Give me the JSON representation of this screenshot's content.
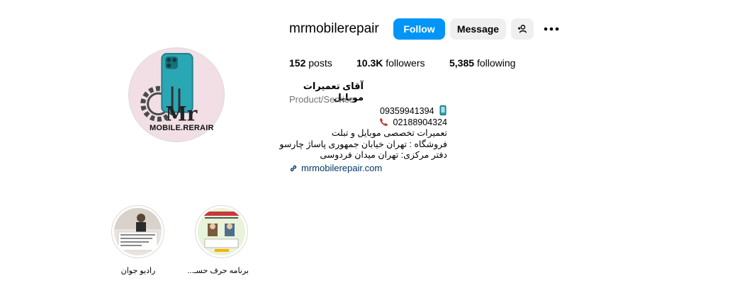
{
  "profile": {
    "username": "mrmobilerepair",
    "avatar_caption": "MOBILE.RERAIR",
    "full_name": "آقای تعمیرات موبایل",
    "category": "Product/Service"
  },
  "actions": {
    "follow_label": "Follow",
    "message_label": "Message",
    "add_user_icon": "add-user-icon",
    "more_icon": "more-icon"
  },
  "stats": {
    "posts_count": "152",
    "posts_label": "posts",
    "followers_count": "10.3K",
    "followers_label": "followers",
    "following_count": "5,385",
    "following_label": "following"
  },
  "bio": {
    "mobile": "09359941394",
    "landline": "02188904324",
    "line1": "تعمیرات تخصصی موبایل و تبلت",
    "line2": "فروشگاه : تهران خیابان جمهوری پاساژ چارسو",
    "line3": "دفتر مرکزی: تهران میدان فردوسی",
    "website": "mrmobilerepair.com"
  },
  "highlights": [
    {
      "label": "رادیو جوان"
    },
    {
      "label": "برنامه حرف حسـ..."
    }
  ],
  "colors": {
    "follow_blue": "#0095f6",
    "link": "#00376b",
    "muted": "#737373",
    "button_gray": "#efefef",
    "phone_accent": "#2aa7b5"
  }
}
